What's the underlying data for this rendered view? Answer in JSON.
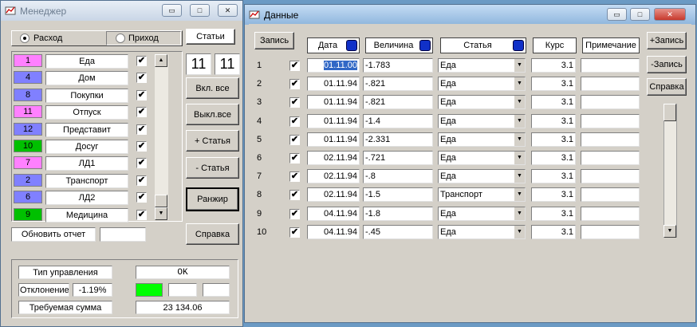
{
  "manager": {
    "title": "Менеджер",
    "radio_expense": "Расход",
    "radio_income": "Приход",
    "tab_articles": "Статьи",
    "categories": [
      {
        "num": "1",
        "name": "Еда",
        "color": "#ff80ff",
        "checked": "✔"
      },
      {
        "num": "4",
        "name": "Дом",
        "color": "#8080ff",
        "checked": "✔"
      },
      {
        "num": "8",
        "name": "Покупки",
        "color": "#8080ff",
        "checked": "✔"
      },
      {
        "num": "11",
        "name": "Отпуск",
        "color": "#ff80ff",
        "checked": "✔"
      },
      {
        "num": "12",
        "name": "Представит",
        "color": "#8080ff",
        "checked": "✔"
      },
      {
        "num": "10",
        "name": "Досуг",
        "color": "#00c000",
        "checked": "✔"
      },
      {
        "num": "7",
        "name": "ЛД1",
        "color": "#ff80ff",
        "checked": "✔"
      },
      {
        "num": "2",
        "name": "Транспорт",
        "color": "#8080ff",
        "checked": "✔"
      },
      {
        "num": "6",
        "name": "ЛД2",
        "color": "#8080ff",
        "checked": "✔"
      },
      {
        "num": "9",
        "name": "Медицина",
        "color": "#00c000",
        "checked": "✔"
      }
    ],
    "count_left": "11",
    "count_right": "11",
    "btn_all_on": "Вкл. все",
    "btn_all_off": "Выкл.все",
    "btn_add_article": "+ Статья",
    "btn_remove_article": "- Статья",
    "btn_rank": "Ранжир",
    "btn_help": "Справка",
    "update_report": "Обновить отчет",
    "update_report_value": "",
    "control_type_label": "Тип управления",
    "control_type_value": "OK",
    "deviation_label": "Отклонение",
    "deviation_value": "-1.19%",
    "required_sum_label": "Требуемая сумма",
    "required_sum_value": "23 134.06",
    "indicator_color": "#00ff00"
  },
  "data_window": {
    "title": "Данные",
    "record_label": "Запись",
    "col_date": "Дата",
    "col_amount": "Величина",
    "col_article": "Статья",
    "col_rate": "Курс",
    "col_note": "Примечание",
    "btn_add_record": "+Запись",
    "btn_remove_record": "-Запись",
    "btn_help": "Справка",
    "rows": [
      {
        "n": "1",
        "check": "✔",
        "date": "01.11.00",
        "amount": "-1.783",
        "article": "Еда",
        "rate": "3.1",
        "note": ""
      },
      {
        "n": "2",
        "check": "✔",
        "date": "01.11.94",
        "amount": "-.821",
        "article": "Еда",
        "rate": "3.1",
        "note": ""
      },
      {
        "n": "3",
        "check": "✔",
        "date": "01.11.94",
        "amount": "-.821",
        "article": "Еда",
        "rate": "3.1",
        "note": ""
      },
      {
        "n": "4",
        "check": "✔",
        "date": "01.11.94",
        "amount": "-1.4",
        "article": "Еда",
        "rate": "3.1",
        "note": ""
      },
      {
        "n": "5",
        "check": "✔",
        "date": "01.11.94",
        "amount": "-2.331",
        "article": "Еда",
        "rate": "3.1",
        "note": ""
      },
      {
        "n": "6",
        "check": "✔",
        "date": "02.11.94",
        "amount": "-.721",
        "article": "Еда",
        "rate": "3.1",
        "note": ""
      },
      {
        "n": "7",
        "check": "✔",
        "date": "02.11.94",
        "amount": "-.8",
        "article": "Еда",
        "rate": "3.1",
        "note": ""
      },
      {
        "n": "8",
        "check": "✔",
        "date": "02.11.94",
        "amount": "-1.5",
        "article": "Транспорт",
        "rate": "3.1",
        "note": ""
      },
      {
        "n": "9",
        "check": "✔",
        "date": "04.11.94",
        "amount": "-1.8",
        "article": "Еда",
        "rate": "3.1",
        "note": ""
      },
      {
        "n": "10",
        "check": "✔",
        "date": "04.11.94",
        "amount": "-.45",
        "article": "Еда",
        "rate": "3.1",
        "note": ""
      }
    ]
  },
  "caption_buttons": {
    "minimize": "▭",
    "maximize": "□",
    "close": "✕"
  }
}
